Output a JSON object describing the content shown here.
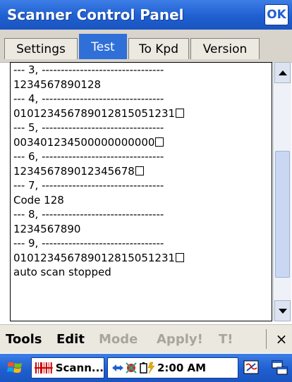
{
  "window": {
    "title": "Scanner Control Panel",
    "ok_label": "OK"
  },
  "tabs": [
    {
      "label": "Settings",
      "active": false
    },
    {
      "label": "Test",
      "active": true
    },
    {
      "label": "To Kpd",
      "active": false
    },
    {
      "label": "Version",
      "active": false
    }
  ],
  "log": {
    "lines": [
      {
        "text": "--- 3, --------------------------------",
        "box": false
      },
      {
        "text": "1234567890128",
        "box": false
      },
      {
        "text": "--- 4, --------------------------------",
        "box": false
      },
      {
        "text": "010123456789012815051231",
        "box": true
      },
      {
        "text": "--- 5, --------------------------------",
        "box": false
      },
      {
        "text": "003401234500000000000",
        "box": true
      },
      {
        "text": "--- 6, --------------------------------",
        "box": false
      },
      {
        "text": "123456789012345678",
        "box": true
      },
      {
        "text": "--- 7, --------------------------------",
        "box": false
      },
      {
        "text": "Code 128",
        "box": false
      },
      {
        "text": "--- 8, --------------------------------",
        "box": false
      },
      {
        "text": "1234567890",
        "box": false
      },
      {
        "text": "--- 9, --------------------------------",
        "box": false
      },
      {
        "text": "010123456789012815051231",
        "box": true
      },
      {
        "text": "",
        "box": false
      },
      {
        "text": "auto scan stopped",
        "box": false
      }
    ]
  },
  "scrollbar": {
    "up_icon": "arrow-up-icon",
    "down_icon": "arrow-down-icon"
  },
  "menubar": {
    "items": [
      {
        "label": "Tools",
        "enabled": true
      },
      {
        "label": "Edit",
        "enabled": true
      },
      {
        "label": "Mode",
        "enabled": false
      },
      {
        "label": "Apply!",
        "enabled": false
      },
      {
        "label": "T!",
        "enabled": false
      }
    ],
    "close_label": "×"
  },
  "taskbar": {
    "task_label": "Scann...",
    "clock": "2:00 AM"
  },
  "colors": {
    "accent": "#1f5fd1",
    "disabled": "#a8a59e"
  }
}
